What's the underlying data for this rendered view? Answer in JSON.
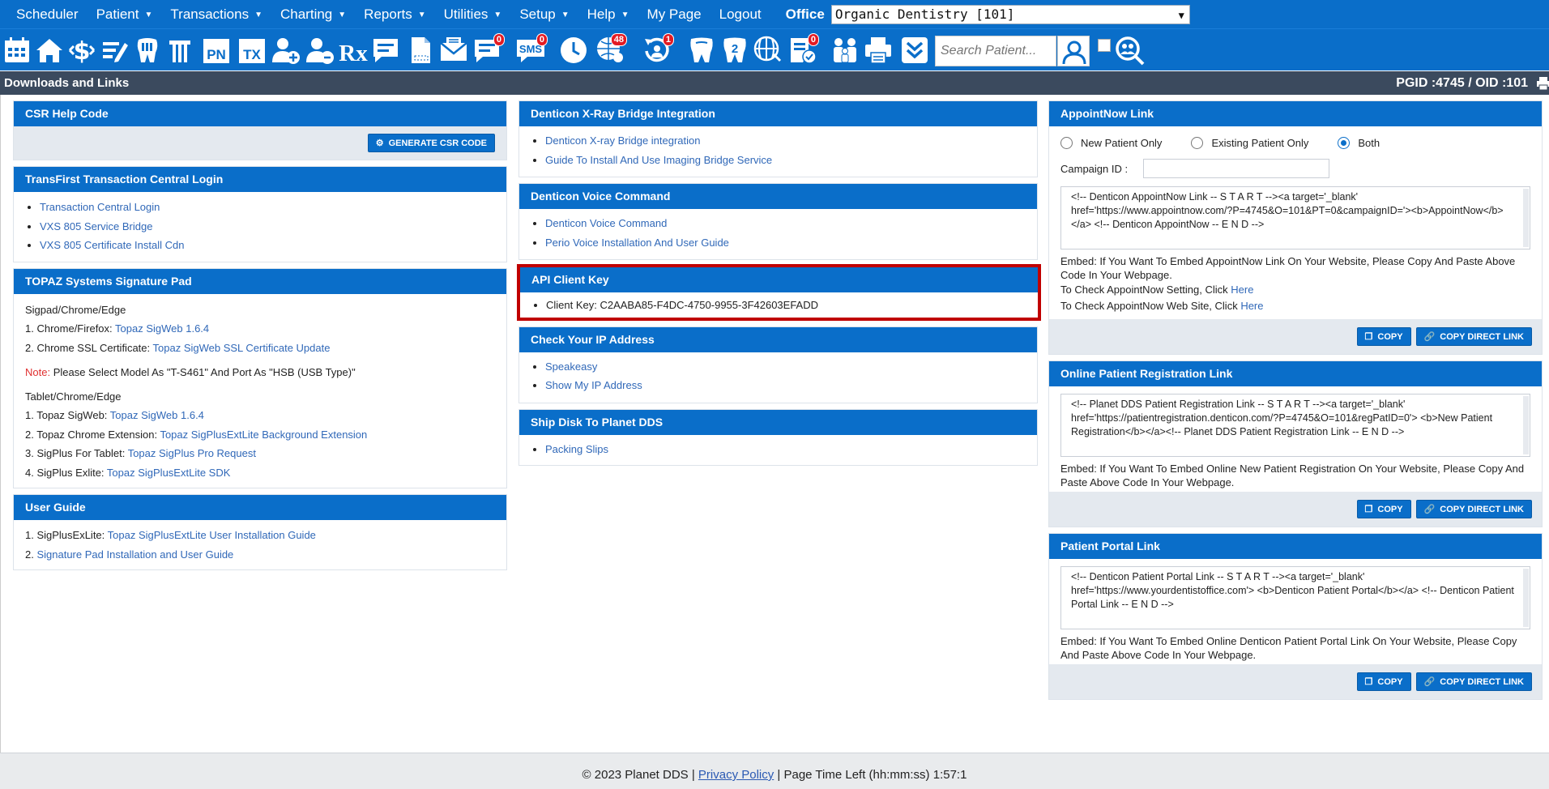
{
  "menu": {
    "items": [
      {
        "label": "Scheduler",
        "caret": false
      },
      {
        "label": "Patient",
        "caret": true
      },
      {
        "label": "Transactions",
        "caret": true
      },
      {
        "label": "Charting",
        "caret": true
      },
      {
        "label": "Reports",
        "caret": true
      },
      {
        "label": "Utilities",
        "caret": true
      },
      {
        "label": "Setup",
        "caret": true
      },
      {
        "label": "Help",
        "caret": true
      },
      {
        "label": "My Page",
        "caret": false
      },
      {
        "label": "Logout",
        "caret": false
      }
    ],
    "office_label": "Office",
    "office_value": "Organic Dentistry [101]"
  },
  "toolbar": {
    "icons": [
      "calendar-icon",
      "home-icon",
      "dollar-icon",
      "edit-icon",
      "tooth-chart-icon",
      "tooth-icon",
      "pn-icon",
      "tx-icon",
      "add-user-icon",
      "add-users-icon",
      "rx-icon",
      "notes-icon",
      "document-icon",
      "mail-icon",
      "message-icon",
      "sms-icon",
      "clock-icon",
      "globe-users-icon",
      "refresh-user-icon",
      "tooth-outline-icon",
      "tooth-2-icon",
      "web-icon",
      "checklist-icon",
      "family-icon",
      "print-icon",
      "chevrons-down-icon"
    ],
    "badges": {
      "message": "0",
      "sms": "0",
      "globe": "48",
      "refresh": "1",
      "checklist": "0"
    },
    "icon_texts": {
      "pn": "PN",
      "tx": "TX",
      "rx": "Rx",
      "sms": "SMS",
      "tooth2": "2"
    },
    "search_placeholder": "Search Patient..."
  },
  "titlebar": {
    "title": "Downloads and Links",
    "ids": "PGID :4745  /  OID :101"
  },
  "csr": {
    "title": "CSR Help Code",
    "button": "GENERATE CSR CODE"
  },
  "transfirst": {
    "title": "TransFirst Transaction Central Login",
    "links": [
      "Transaction Central Login",
      "VXS 805 Service Bridge",
      "VXS 805 Certificate Install Cdn"
    ]
  },
  "topaz": {
    "title": "TOPAZ Systems Signature Pad",
    "sec1": "Sigpad/Chrome/Edge",
    "line1_prefix": "1. Chrome/Firefox: ",
    "line1_link": "Topaz SigWeb 1.6.4",
    "line2_prefix": "2. Chrome SSL Certificate: ",
    "line2_link": "Topaz SigWeb SSL Certificate Update",
    "note_label": "Note:",
    "note_text": " Please Select Model As \"T-S461\" And Port As \"HSB (USB Type)\"",
    "sec2": "Tablet/Chrome/Edge",
    "t1_prefix": "1. Topaz SigWeb: ",
    "t1_link": "Topaz SigWeb 1.6.4",
    "t2_prefix": "2. Topaz Chrome Extension: ",
    "t2_link": "Topaz SigPlusExtLite Background Extension",
    "t3_prefix": "3. SigPlus For Tablet: ",
    "t3_link": "Topaz SigPlus Pro Request",
    "t4_prefix": "4. SigPlus Exlite: ",
    "t4_link": "Topaz SigPlusExtLite SDK"
  },
  "userguide": {
    "title": "User Guide",
    "l1_prefix": "1. SigPlusExLite: ",
    "l1_link": "Topaz SigPlusExtLite User Installation Guide",
    "l2_prefix": "2. ",
    "l2_link": "Signature Pad Installation and User Guide"
  },
  "xray": {
    "title": "Denticon X-Ray Bridge Integration",
    "links": [
      "Denticon X-ray Bridge integration",
      "Guide To Install And Use Imaging Bridge Service"
    ]
  },
  "voice": {
    "title": "Denticon Voice Command",
    "links": [
      "Denticon Voice Command",
      "Perio Voice Installation And User Guide"
    ]
  },
  "apikey": {
    "title": "API Client Key",
    "text": "Client Key: C2AABA85-F4DC-4750-9955-3F42603EFADD"
  },
  "ipaddr": {
    "title": "Check Your IP Address",
    "links": [
      "Speakeasy",
      "Show My IP Address"
    ]
  },
  "shipdisk": {
    "title": "Ship Disk To Planet DDS",
    "links": [
      "Packing Slips"
    ]
  },
  "appointnow": {
    "title": "AppointNow Link",
    "radios": [
      {
        "label": "New Patient Only",
        "checked": false
      },
      {
        "label": "Existing Patient Only",
        "checked": false
      },
      {
        "label": "Both",
        "checked": true
      }
    ],
    "campaign_label": "Campaign ID :",
    "campaign_value": "",
    "code": "<!-- Denticon AppointNow Link --  S T A R T --><a target='_blank' href='https://www.appointnow.com/?P=4745&O=101&PT=0&campaignID='><b>AppointNow</b></a> <!-- Denticon AppointNow --  E N D -->",
    "embed": "Embed: If You Want To Embed AppointNow Link On Your Website, Please Copy And Paste Above Code In Your Webpage.",
    "check1_prefix": "To Check AppointNow Setting, Click ",
    "check1_link": "Here",
    "check2_prefix": "To Check AppointNow Web Site, Click ",
    "check2_link": "Here",
    "copy": "COPY",
    "copy_direct": "COPY DIRECT LINK"
  },
  "registration": {
    "title": "Online Patient Registration Link",
    "code": "<!-- Planet DDS Patient Registration Link --  S T A R T --><a target='_blank' href='https://patientregistration.denticon.com/?P=4745&O=101&regPatID=0'> <b>New Patient Registration</b></a><!-- Planet DDS Patient Registration Link --  E N D -->",
    "embed": "Embed: If You Want To Embed Online New Patient Registration On Your Website, Please Copy And Paste Above Code In Your Webpage.",
    "copy": "COPY",
    "copy_direct": "COPY DIRECT LINK"
  },
  "portal": {
    "title": "Patient Portal Link",
    "code": "<!-- Denticon Patient Portal Link --  S T A R T --><a target='_blank' href='https://www.yourdentistoffice.com'> <b>Denticon Patient Portal</b></a> <!-- Denticon Patient Portal Link --  E N D -->",
    "embed": "Embed: If You Want To Embed Online Denticon Patient Portal Link On Your Website, Please Copy And Paste Above Code In Your Webpage.",
    "copy": "COPY",
    "copy_direct": "COPY DIRECT LINK"
  },
  "footer": {
    "copyright": "© 2023 Planet DDS | ",
    "privacy": "Privacy Policy",
    "time": " |  Page Time Left (hh:mm:ss) 1:57:1"
  },
  "colors": {
    "brand_blue": "#0a6ec9",
    "title_bar": "#3b4a5e",
    "highlight": "#c00000",
    "badge": "#e31b23"
  }
}
